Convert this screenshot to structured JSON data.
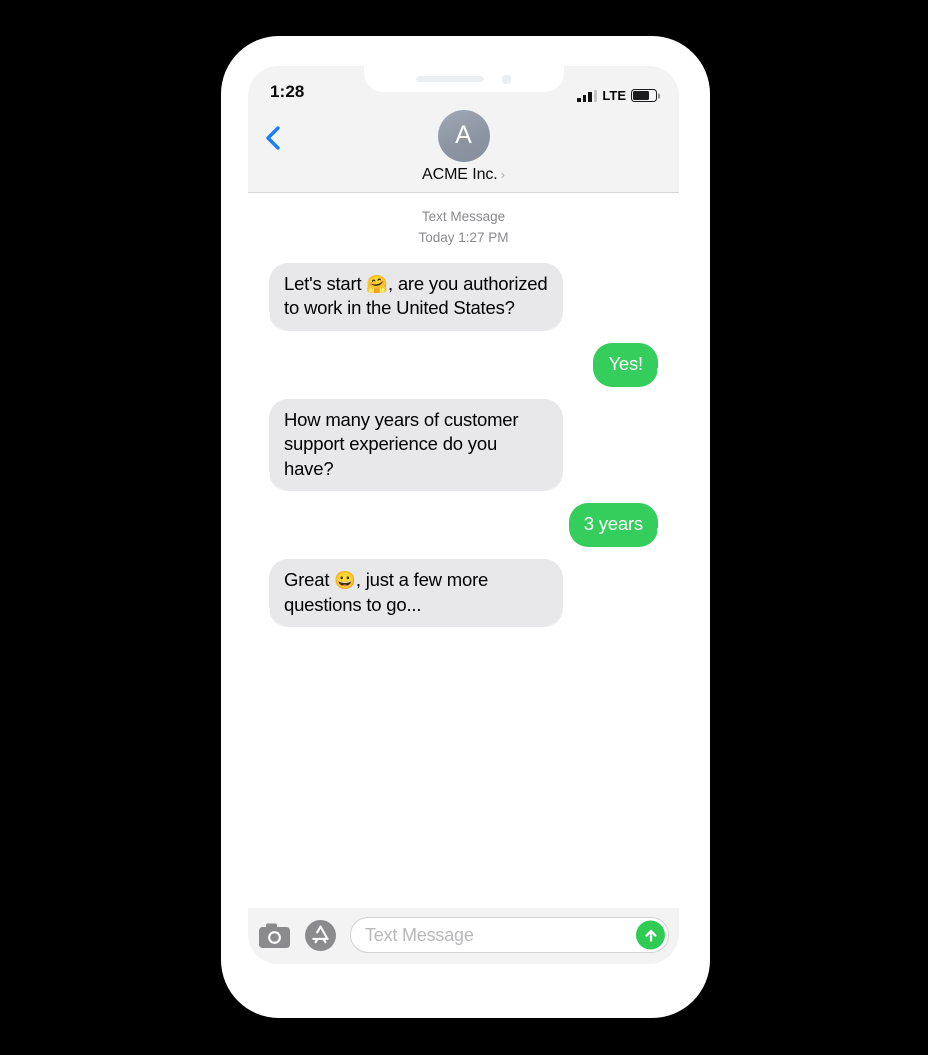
{
  "device": {
    "name": "iphone-x",
    "frame_color": "#ffffff",
    "background_color": "#000000"
  },
  "status_bar": {
    "time": "1:28",
    "network_label": "LTE",
    "signal_bars_total": 4,
    "signal_bars_filled": 3,
    "battery_percent": 72,
    "icons": {
      "signal": "cellular-signal-icon",
      "battery": "battery-icon"
    }
  },
  "nav_bar": {
    "back_icon": "chevron-left-icon",
    "avatar_initial": "A",
    "contact_name": "ACME Inc.",
    "disclosure_icon": "chevron-right-icon"
  },
  "thread": {
    "stamp_label": "Text Message",
    "stamp_time": "Today 1:27 PM",
    "messages": [
      {
        "direction": "incoming",
        "text_before": "Let's start ",
        "emoji": "🤗",
        "text_after": ", are you authorized to work in the United States?",
        "full_text": "Let's start 🤗, are you authorized to work in the United States?"
      },
      {
        "direction": "outgoing",
        "text_before": "Yes!",
        "emoji": "",
        "text_after": "",
        "full_text": "Yes!"
      },
      {
        "direction": "incoming",
        "text_before": "How many years of customer support experience do you have?",
        "emoji": "",
        "text_after": "",
        "full_text": "How many years of customer support experience do you have?"
      },
      {
        "direction": "outgoing",
        "text_before": "3 years",
        "emoji": "",
        "text_after": "",
        "full_text": "3 years"
      },
      {
        "direction": "incoming",
        "text_before": "Great ",
        "emoji": "😀",
        "text_after": ", just a few more questions to go...",
        "full_text": "Great 😀, just a few more questions to go..."
      }
    ]
  },
  "input_bar": {
    "camera_icon": "camera-icon",
    "appstore_icon": "app-store-icon",
    "placeholder": "Text Message",
    "value": "",
    "send_icon": "arrow-up-icon"
  },
  "colors": {
    "outgoing_bubble": "#35ce5c",
    "incoming_bubble": "#e8e8ea",
    "send_button": "#2fcc54",
    "accent_blue": "#1a7fef",
    "chrome_gray": "#f3f3f4"
  }
}
